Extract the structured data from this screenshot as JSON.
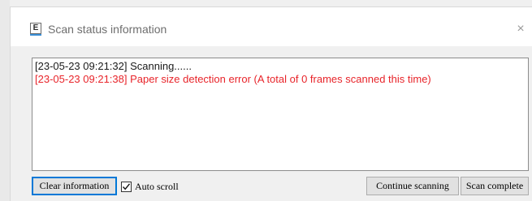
{
  "window": {
    "icon_letter": "E",
    "title": "Scan status information",
    "close_glyph": "×"
  },
  "log": {
    "lines": [
      {
        "text": "[23-05-23 09:21:32]  Scanning......",
        "color": "#1a1a1a"
      },
      {
        "text": "[23-05-23 09:21:38]  Paper size detection error (A total of 0 frames scanned this time)",
        "color": "#e8242a"
      }
    ]
  },
  "controls": {
    "clear_label": "Clear information",
    "auto_scroll_label": "Auto scroll",
    "auto_scroll_checked": true,
    "continue_label": "Continue scanning",
    "complete_label": "Scan complete"
  },
  "colors": {
    "accent": "#0078d7",
    "error": "#e8242a"
  }
}
